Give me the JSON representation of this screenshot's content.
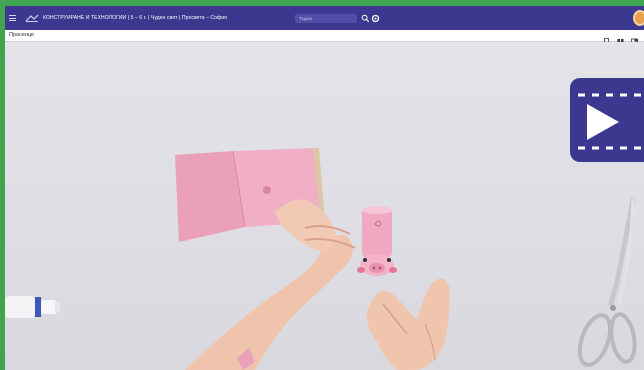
{
  "header": {
    "title": "КОНСТРУИРАНЕ И ТЕХНОЛОГИИ | 5 – 6 г. | Чуден свят | Просвета – София",
    "search_placeholder": "Търси"
  },
  "subheader": {
    "title": "Прасенце"
  },
  "icons": {
    "menu": "menu-icon",
    "logo": "logo-icon",
    "search": "search-icon",
    "settings": "gear-icon",
    "bookmark": "bookmark-icon",
    "pages": "pages-icon",
    "window": "window-icon",
    "play": "play-icon"
  },
  "colors": {
    "header_bg": "#3c3890",
    "page_bg": "#3fa64f",
    "play_bg": "#3c3890"
  }
}
